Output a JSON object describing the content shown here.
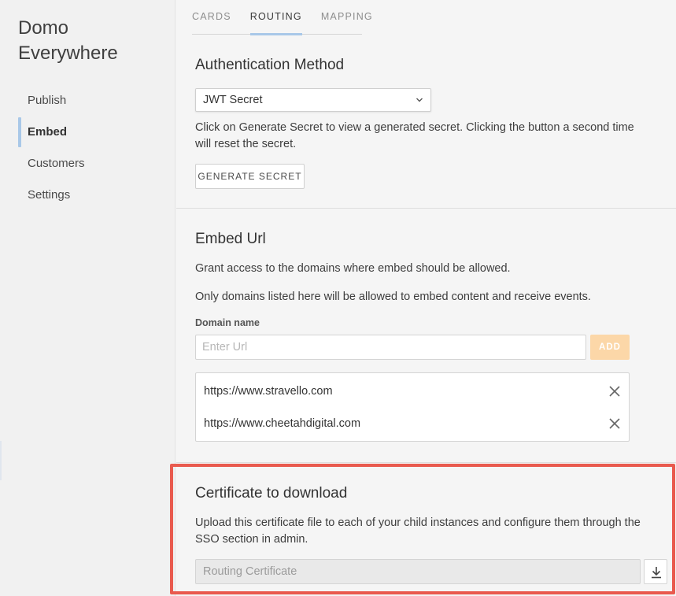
{
  "sidebar": {
    "app_title": "Domo Everywhere",
    "items": [
      {
        "label": "Publish"
      },
      {
        "label": "Embed"
      },
      {
        "label": "Customers"
      },
      {
        "label": "Settings"
      }
    ]
  },
  "tabs": [
    {
      "label": "CARDS"
    },
    {
      "label": "ROUTING"
    },
    {
      "label": "MAPPING"
    }
  ],
  "auth": {
    "title": "Authentication Method",
    "selected_method": "JWT Secret",
    "description": "Click on Generate Secret to view a generated secret. Clicking the button a second time will reset the secret.",
    "generate_button": "GENERATE SECRET"
  },
  "embed_url": {
    "title": "Embed Url",
    "description_1": "Grant access to the domains where embed should be allowed.",
    "description_2": "Only domains listed here will be allowed to embed content and receive events.",
    "field_label": "Domain name",
    "input_placeholder": "Enter Url",
    "add_button": "ADD",
    "domains": [
      {
        "url": "https://www.stravello.com"
      },
      {
        "url": "https://www.cheetahdigital.com"
      }
    ]
  },
  "certificate": {
    "title": "Certificate to download",
    "description": "Upload this certificate file to each of your child instances and configure them through the SSO section in admin.",
    "field_value": "Routing Certificate"
  },
  "colors": {
    "accent_tab": "#a9c8e8",
    "add_button_bg": "#fcd7a8",
    "highlight_border": "#e95a4e"
  }
}
